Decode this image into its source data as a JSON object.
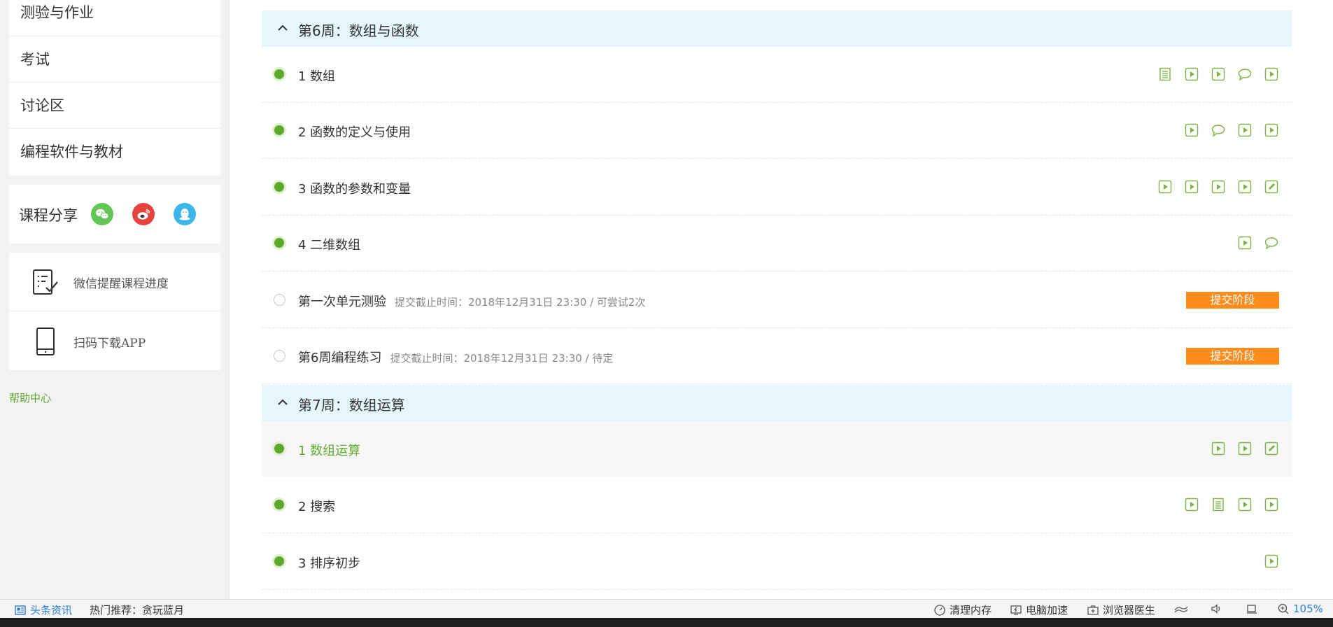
{
  "sidebar": {
    "menu": [
      "测验与作业",
      "考试",
      "讨论区",
      "编程软件与教材"
    ],
    "share_label": "课程分享",
    "share_icons": [
      "wechat-icon",
      "weibo-icon",
      "qq-icon"
    ],
    "tools": [
      {
        "icon": "checklist-icon",
        "label": "微信提醒课程进度"
      },
      {
        "icon": "tablet-icon",
        "label": "扫码下载APP"
      }
    ],
    "help": "帮助中心"
  },
  "weeks": [
    {
      "title": "第6周：数组与函数",
      "lessons": [
        {
          "title": "1 数组",
          "icons": [
            "doc",
            "video",
            "video",
            "discuss",
            "video"
          ]
        },
        {
          "title": "2 函数的定义与使用",
          "icons": [
            "video",
            "discuss",
            "video",
            "video"
          ]
        },
        {
          "title": "3 函数的参数和变量",
          "icons": [
            "video",
            "video",
            "video",
            "video",
            "edit"
          ]
        },
        {
          "title": "4 二维数组",
          "icons": [
            "video",
            "discuss"
          ]
        },
        {
          "title": "第一次单元测验",
          "sub": "提交截止时间：2018年12月31日 23:30 / 可尝试2次",
          "status": "提交阶段"
        },
        {
          "title": "第6周编程练习",
          "sub": "提交截止时间：2018年12月31日 23:30 / 待定",
          "status": "提交阶段"
        }
      ]
    },
    {
      "title": "第7周：数组运算",
      "lessons": [
        {
          "title": "1 数组运算",
          "icons": [
            "video",
            "video",
            "edit"
          ],
          "highlight": true
        },
        {
          "title": "2 搜索",
          "icons": [
            "video",
            "doc",
            "video",
            "video"
          ]
        },
        {
          "title": "3 排序初步",
          "icons": [
            "video"
          ]
        }
      ]
    }
  ],
  "statusbar": {
    "news": "头条资讯",
    "hot": "热门推荐：贪玩蓝月",
    "clean": "清理内存",
    "speed": "电脑加速",
    "doctor": "浏览器医生",
    "zoom": "105%"
  },
  "colors": {
    "accent_green": "#5fa82e",
    "header_bg": "#e5f6fd",
    "status_orange": "#ff8c1a"
  }
}
